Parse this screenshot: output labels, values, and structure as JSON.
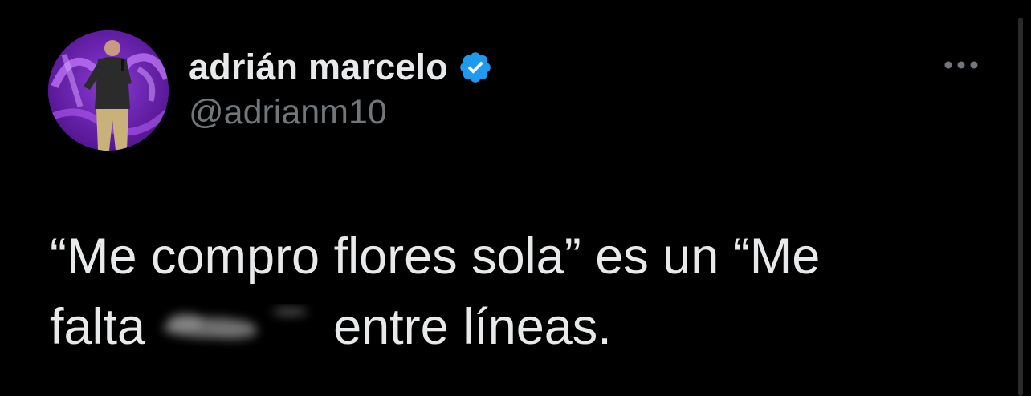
{
  "tweet": {
    "author": {
      "display_name": "adrián marcelo",
      "handle": "@adrianm10",
      "verified": true,
      "avatar_icon": "avatar-photo"
    },
    "more_icon": "more-horizontal-icon",
    "text": {
      "line1": "“Me compro flores sola” es un “Me",
      "line2_start": "falta",
      "line2_end": "entre líneas."
    }
  },
  "colors": {
    "background": "#000000",
    "primary_text": "#e7e9ea",
    "secondary_text": "#71767b",
    "verified_blue": "#1d9bf0",
    "avatar_purple": "#6a1fb0"
  }
}
